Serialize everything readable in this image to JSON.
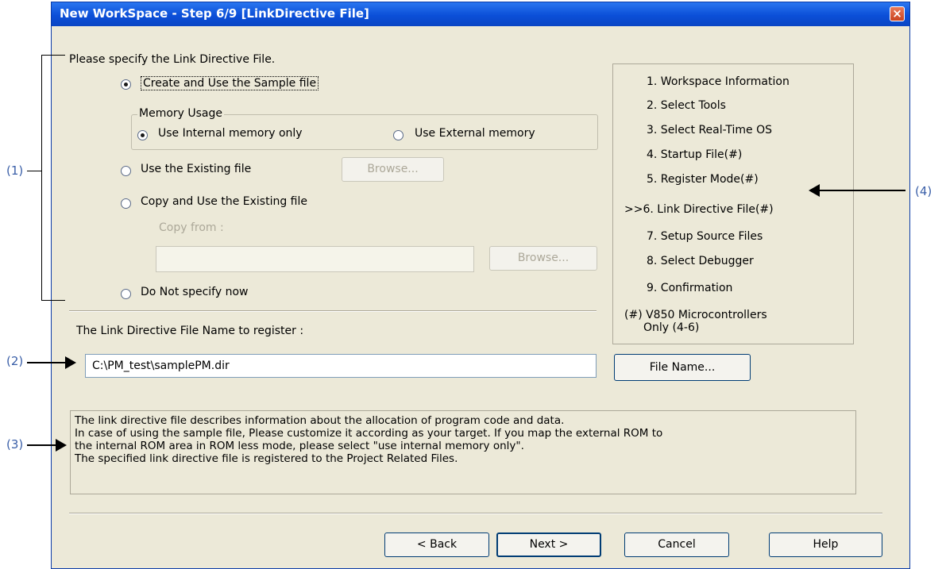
{
  "window": {
    "title": "New WorkSpace - Step 6/9 [LinkDirective File]"
  },
  "section_label": "Please specify the Link Directive File.",
  "options": {
    "create_sample": "Create and Use the Sample file",
    "memory_usage_label": "Memory Usage",
    "use_internal": "Use Internal memory only",
    "use_external": "Use External memory",
    "use_existing": "Use the Existing file",
    "copy_existing": "Copy and Use the Existing file",
    "copy_from_label": "Copy from :",
    "copy_from_value": "",
    "do_not_specify": "Do Not specify now",
    "browse_label": "Browse..."
  },
  "register": {
    "label": "The Link Directive File Name to register :",
    "value": "C:\\PM_test\\samplePM.dir",
    "file_name_button": "File Name..."
  },
  "steps": {
    "items": [
      "1. Workspace Information",
      "2. Select Tools",
      "3. Select Real-Time OS",
      "4. Startup File(#)",
      "5. Register Mode(#)",
      ">>6. Link Directive File(#)",
      "7. Setup Source Files",
      "8. Select Debugger",
      "9. Confirmation"
    ],
    "note_line1": "(#) V850 Microcontrollers",
    "note_line2": "Only (4-6)"
  },
  "description": {
    "line1": "The link directive file describes information about the allocation of program code and data.",
    "line2": "In case of using the sample file, Please customize it according as your target. If you map the external ROM to",
    "line3": "the internal ROM area in ROM less mode, please select \"use internal memory only\".",
    "line4": "The specified link directive file is registered to the Project Related Files."
  },
  "buttons": {
    "back": "< Back",
    "next": "Next >",
    "cancel": "Cancel",
    "help": "Help"
  },
  "annotations": {
    "a1": "(1)",
    "a2": "(2)",
    "a3": "(3)",
    "a4": "(4)"
  }
}
